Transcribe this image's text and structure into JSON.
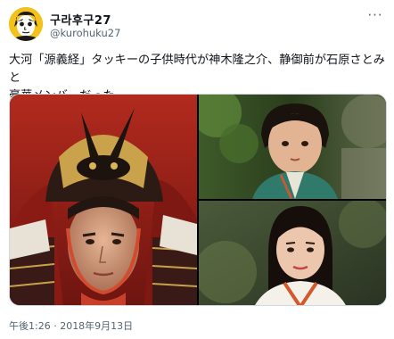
{
  "user": {
    "display_name": "구라후구27",
    "handle": "@kurohuku27"
  },
  "tweet": {
    "line1": "大河「源義経」タッキーの子供時代が神木隆之介、静御前が石原さとみと",
    "line2": "豪華メンバーだった"
  },
  "meta": {
    "timestamp": "午後1:26 · 2018年9月13日"
  },
  "media": {
    "images": [
      {
        "subject": "actor-in-samurai-armor"
      },
      {
        "subject": "child-in-green-kimono"
      },
      {
        "subject": "actress-in-white-kimono"
      }
    ]
  },
  "colors": {
    "text": "#0f1419",
    "secondary": "#536471",
    "avatar_bg": "#f2c21b"
  }
}
